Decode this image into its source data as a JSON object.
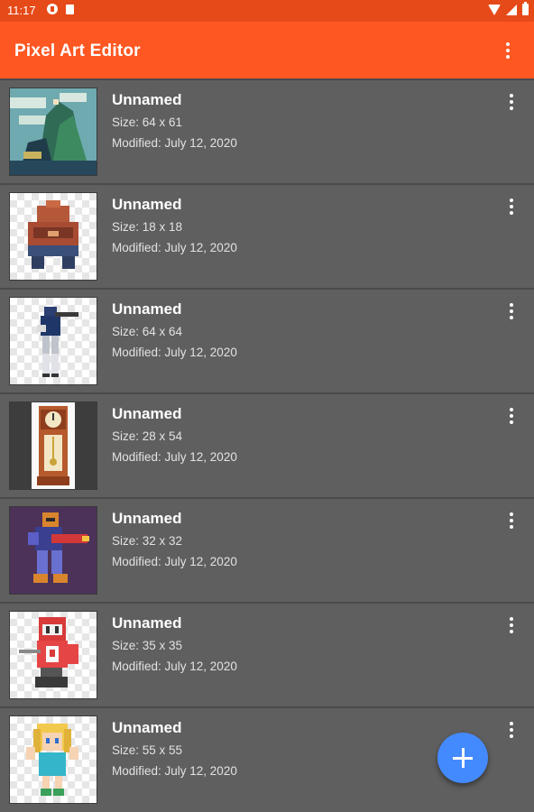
{
  "status_bar": {
    "time": "11:17"
  },
  "app_bar": {
    "title": "Pixel Art Editor"
  },
  "files": [
    {
      "name": "Unnamed",
      "size": "Size: 64 x 61",
      "modified": "Modified: July 12, 2020",
      "thumbnail": "landscape"
    },
    {
      "name": "Unnamed",
      "size": "Size: 18 x 18",
      "modified": "Modified: July 12, 2020",
      "thumbnail": "robot"
    },
    {
      "name": "Unnamed",
      "size": "Size: 64 x 64",
      "modified": "Modified: July 12, 2020",
      "thumbnail": "soldier"
    },
    {
      "name": "Unnamed",
      "size": "Size: 28 x 54",
      "modified": "Modified: July 12, 2020",
      "thumbnail": "grandfather-clock"
    },
    {
      "name": "Unnamed",
      "size": "Size: 32 x 32",
      "modified": "Modified: July 12, 2020",
      "thumbnail": "armored-gunner"
    },
    {
      "name": "Unnamed",
      "size": "Size: 35 x 35",
      "modified": "Modified: July 12, 2020",
      "thumbnail": "red-knight"
    },
    {
      "name": "Unnamed",
      "size": "Size: 55 x 55",
      "modified": "Modified: July 12, 2020",
      "thumbnail": "blonde-girl"
    }
  ],
  "fab": {
    "icon": "plus-icon"
  },
  "colors": {
    "status_bar": "#e64a19",
    "app_bar": "#ff5722",
    "list_background": "#5e5e5e",
    "fab": "#448aff"
  }
}
